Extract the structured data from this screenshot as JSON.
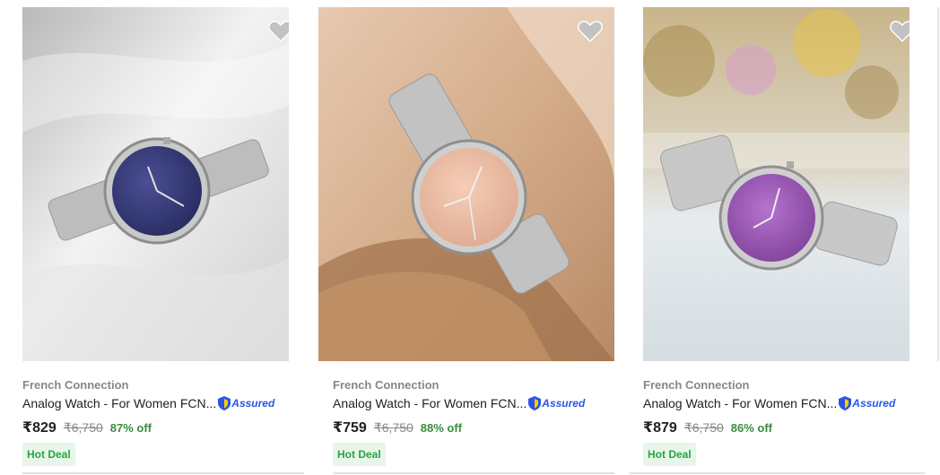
{
  "products": [
    {
      "brand": "French Connection",
      "title": "Analog Watch - For Women FCN...",
      "assured_label": "Assured",
      "price": "₹829",
      "mrp": "₹6,750",
      "discount": "87% off",
      "deal_badge": "Hot Deal",
      "dial_color": "#3a3d7a",
      "background_color": "#d8d8d8",
      "wishlist_icon": "heart-icon"
    },
    {
      "brand": "French Connection",
      "title": "Analog Watch - For Women FCN...",
      "assured_label": "Assured",
      "price": "₹759",
      "mrp": "₹6,750",
      "discount": "88% off",
      "deal_badge": "Hot Deal",
      "dial_color": "#e9b9a0",
      "background_color": "#d9b596",
      "wishlist_icon": "heart-icon"
    },
    {
      "brand": "French Connection",
      "title": "Analog Watch - For Women FCN...",
      "assured_label": "Assured",
      "price": "₹879",
      "mrp": "₹6,750",
      "discount": "86% off",
      "deal_badge": "Hot Deal",
      "dial_color": "#9c58b6",
      "background_color": "#dde3e6",
      "wishlist_icon": "heart-icon"
    }
  ],
  "colors": {
    "discount_green": "#388e3c",
    "deal_badge_bg": "#e8f6ea",
    "assured_blue": "#2a55e5",
    "brand_grey": "#878787"
  }
}
